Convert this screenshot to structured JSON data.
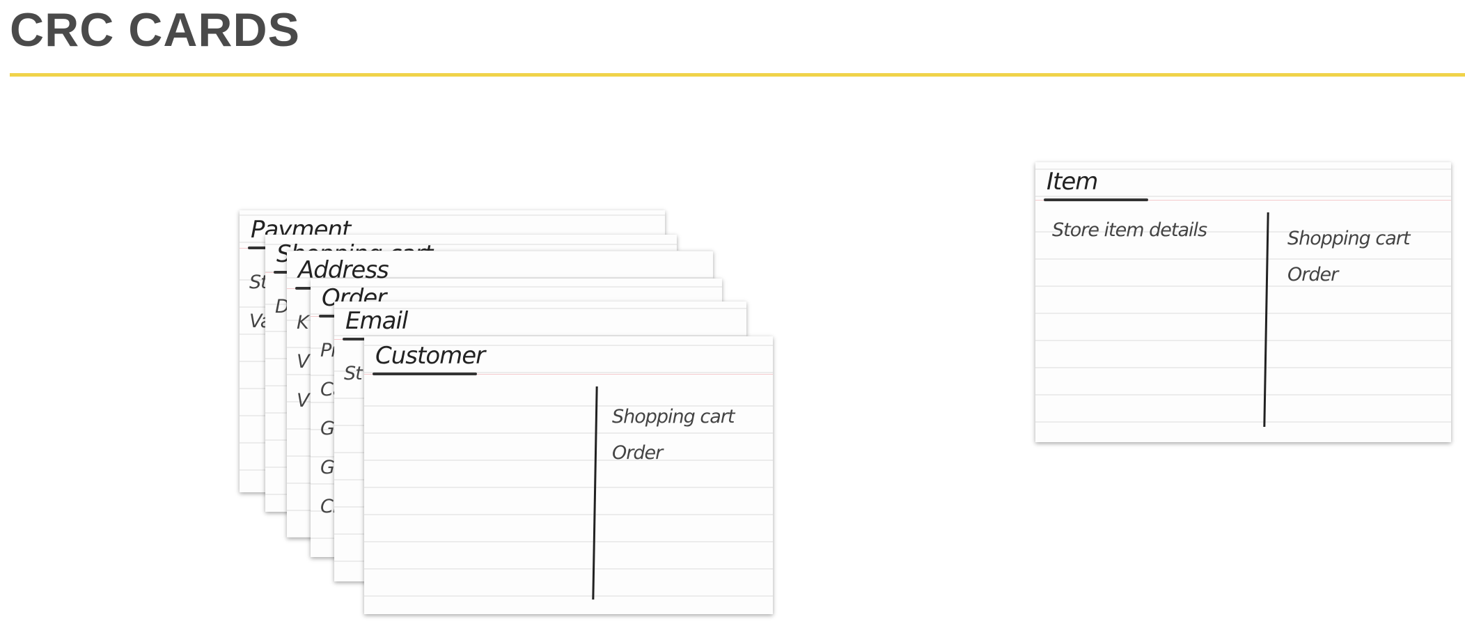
{
  "page": {
    "title": "CRC CARDS",
    "accent_color": "#f0d34a"
  },
  "stack": [
    {
      "name": "Payment",
      "responsibilities": [
        "St",
        "Va"
      ],
      "collaborators": []
    },
    {
      "name": "Shopping cart",
      "responsibilities": [
        "D"
      ],
      "collaborators": []
    },
    {
      "name": "Address",
      "responsibilities": [
        "K",
        "V",
        "V"
      ],
      "collaborators": []
    },
    {
      "name": "Order",
      "responsibilities": [
        "Pr",
        "Ca",
        "Ge",
        "Ge",
        "Cr"
      ],
      "collaborators": []
    },
    {
      "name": "Email",
      "responsibilities": [
        "St"
      ],
      "collaborators": []
    },
    {
      "name": "Customer",
      "responsibilities": [],
      "collaborators": [
        "Shopping cart",
        "Order"
      ]
    }
  ],
  "item_card": {
    "name": "Item",
    "responsibilities": [
      "Store item details"
    ],
    "collaborators": [
      "Shopping cart",
      "Order"
    ]
  }
}
